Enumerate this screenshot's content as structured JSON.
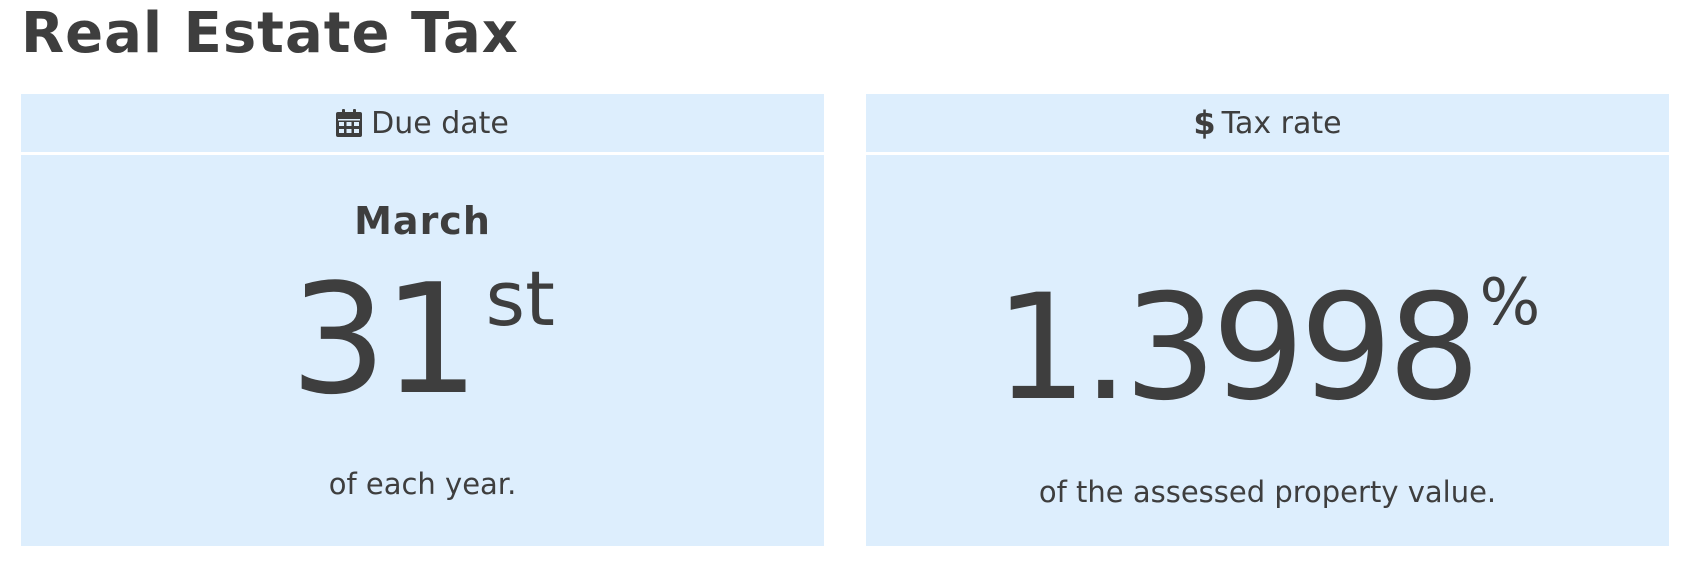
{
  "page": {
    "title": "Real Estate Tax"
  },
  "colors": {
    "card_background": "#ddeefd",
    "text": "#3e3e3e",
    "divider": "#ffffff"
  },
  "due_date_card": {
    "icon": "calendar-icon",
    "header_label": "Due date",
    "month": "March",
    "day": "31",
    "day_suffix": "st",
    "footnote": "of each year."
  },
  "tax_rate_card": {
    "icon": "dollar-icon",
    "icon_glyph": "$",
    "header_label": "Tax rate",
    "rate": "1.3998",
    "rate_suffix": "%",
    "footnote": "of the assessed property value."
  }
}
